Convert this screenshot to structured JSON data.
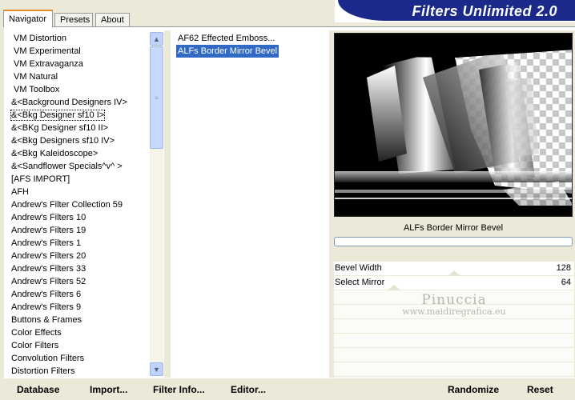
{
  "tabs": {
    "navigator": "Navigator",
    "presets": "Presets",
    "about": "About"
  },
  "banner_title": "Filters Unlimited 2.0",
  "categories": [
    "VM Distortion",
    "VM Experimental",
    "VM Extravaganza",
    "VM Natural",
    "VM Toolbox",
    "&<Background Designers IV>",
    "&<Bkg Designer sf10 I>",
    "&<BKg Designer sf10 II>",
    "&<Bkg Designers sf10 IV>",
    "&<Bkg Kaleidoscope>",
    "&<Sandflower Specials^v^ >",
    "[AFS IMPORT]",
    "AFH",
    "Andrew's Filter Collection 59",
    "Andrew's Filters 10",
    "Andrew's Filters 19",
    "Andrew's Filters 1",
    "Andrew's Filters 20",
    "Andrew's Filters 33",
    "Andrew's Filters 52",
    "Andrew's Filters 6",
    "Andrew's Filters 9",
    "Buttons & Frames",
    "Color Effects",
    "Color Filters",
    "Convolution Filters",
    "Distortion Filters"
  ],
  "selected_category_index": 6,
  "filters": [
    "AF62 Effected Emboss...",
    "ALFs Border Mirror Bevel"
  ],
  "selected_filter_index": 1,
  "selected_filter_title": "ALFs Border Mirror Bevel",
  "progress_fraction": 0,
  "sliders": [
    {
      "label": "Bevel Width",
      "value": "128",
      "level": 0.5
    },
    {
      "label": "Select Mirror",
      "value": "64",
      "level": 0.25
    }
  ],
  "watermark": {
    "line1": "Pinuccia",
    "line2": "www.maidiregrafica.eu"
  },
  "buttons": {
    "database": "Database",
    "import": "Import...",
    "filter_info": "Filter Info...",
    "editor": "Editor...",
    "randomize": "Randomize",
    "reset": "Reset"
  },
  "colors": {
    "banner": "#1b2a8a",
    "selection": "#316ac5",
    "tab_highlight": "#e68b2c"
  }
}
